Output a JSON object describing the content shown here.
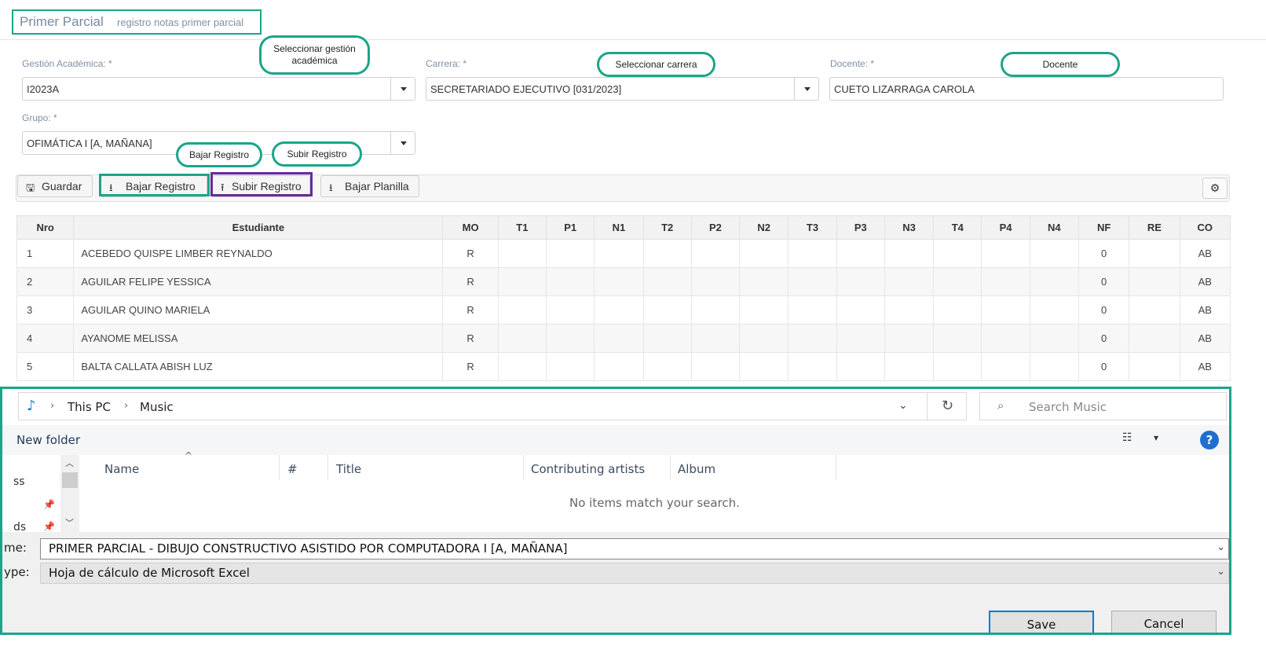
{
  "header": {
    "title": "Primer Parcial",
    "subtitle": "registro notas primer parcial"
  },
  "form": {
    "gestion_label": "Gestión Académica:  *",
    "gestion_value": "I2023A",
    "carrera_label": "Carrera:  *",
    "carrera_value": "SECRETARIADO EJECUTIVO [031/2023]",
    "docente_label": "Docente: *",
    "docente_value": "CUETO LIZARRAGA  CAROLA",
    "grupo_label": "Grupo:  *",
    "grupo_value": "OFIMÁTICA I [A, MAÑANA]"
  },
  "callouts": {
    "gestion": "Seleccionar gestión académica",
    "carrera": "Seleccionar carrera",
    "docente": "Docente",
    "bajar": "Bajar Registro",
    "subir": "Subir Registro"
  },
  "toolbar": {
    "guardar": "Guardar",
    "bajar_registro": "Bajar Registro",
    "subir_registro": "Subir Registro",
    "bajar_planilla": "Bajar Planilla"
  },
  "table": {
    "headers": [
      "Nro",
      "Estudiante",
      "MO",
      "T1",
      "P1",
      "N1",
      "T2",
      "P2",
      "N2",
      "T3",
      "P3",
      "N3",
      "T4",
      "P4",
      "N4",
      "NF",
      "RE",
      "CO"
    ],
    "rows": [
      {
        "nro": "1",
        "estudiante": "ACEBEDO QUISPE LIMBER REYNALDO",
        "mo": "R",
        "nf": "0",
        "co": "AB"
      },
      {
        "nro": "2",
        "estudiante": "AGUILAR FELIPE YESSICA",
        "mo": "R",
        "nf": "0",
        "co": "AB"
      },
      {
        "nro": "3",
        "estudiante": "AGUILAR QUINO MARIELA",
        "mo": "R",
        "nf": "0",
        "co": "AB"
      },
      {
        "nro": "4",
        "estudiante": "AYANOME MELISSA",
        "mo": "R",
        "nf": "0",
        "co": "AB"
      },
      {
        "nro": "5",
        "estudiante": "BALTA CALLATA ABISH LUZ",
        "mo": "R",
        "nf": "0",
        "co": "AB"
      }
    ]
  },
  "dialog": {
    "path": [
      "This PC",
      "Music"
    ],
    "search_placeholder": "Search Music",
    "new_folder": "New folder",
    "nav_items": [
      "ss",
      "ds"
    ],
    "columns": [
      "Name",
      "#",
      "Title",
      "Contributing artists",
      "Album"
    ],
    "empty_message": "No items match your search.",
    "filename_label": "me:",
    "filename_value": "PRIMER PARCIAL - DIBUJO CONSTRUCTIVO ASISTIDO POR COMPUTADORA I [A, MAÑANA]",
    "filetype_label": "ype:",
    "filetype_value": "Hoja de cálculo de Microsoft Excel",
    "save": "Save",
    "cancel": "Cancel"
  },
  "colors": {
    "highlight_green": "#1aa589",
    "highlight_purple": "#6a2a98",
    "accent_blue": "#0078d7"
  }
}
